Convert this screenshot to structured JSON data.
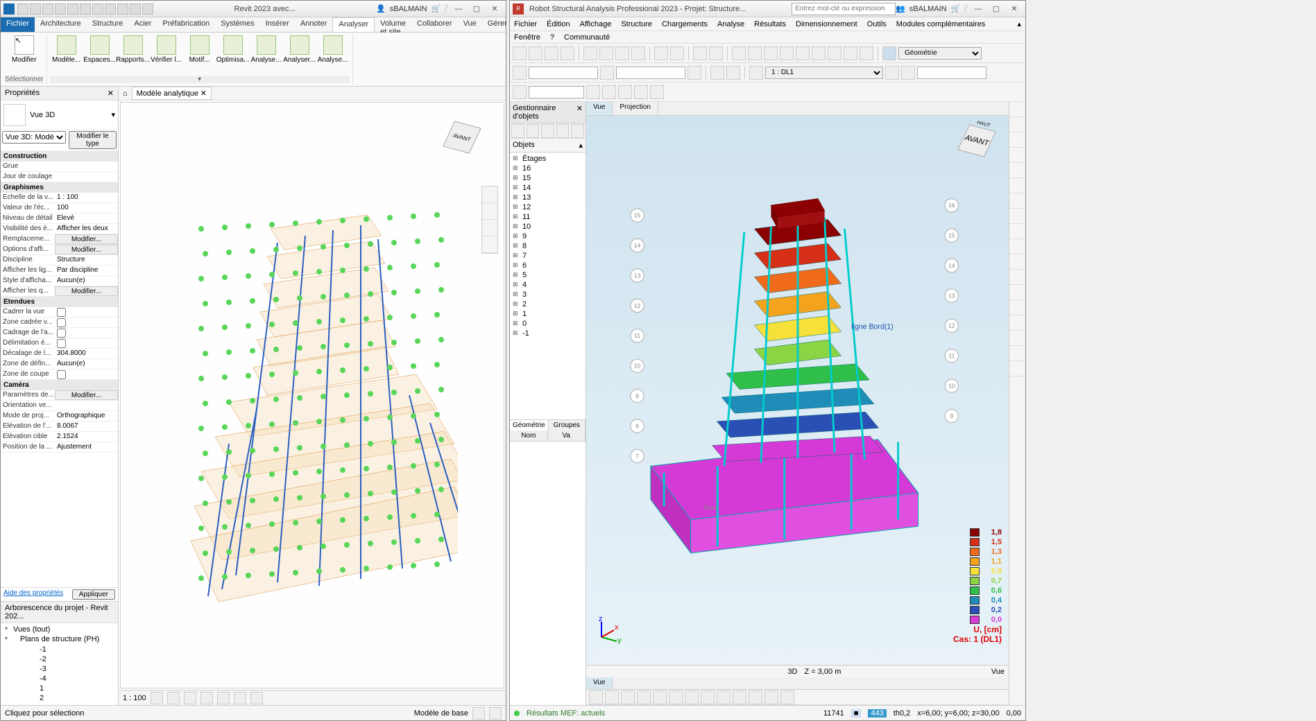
{
  "revit": {
    "title": "Revit 2023 avec...",
    "user": "sBALMAIN",
    "tabs": [
      "Fichier",
      "Architecture",
      "Structure",
      "Acier",
      "Préfabrication",
      "Systèmes",
      "Insérer",
      "Annoter",
      "Analyser",
      "Volume et site",
      "Collaborer",
      "Vue",
      "Gérer"
    ],
    "active_tab": "Analyser",
    "ribbon": {
      "select_panel": "Sélectionner",
      "buttons": [
        "Modifier",
        "Modèle...",
        "Espaces...",
        "Rapports...",
        "Vérifier l...",
        "Motif...",
        "Optimisa...",
        "Analyse...",
        "Analyser...",
        "Analyse..."
      ]
    },
    "view_tab": "Modèle analytique",
    "viewcube_face": "AVANT",
    "properties": {
      "header": "Propriétés",
      "type_name": "Vue 3D",
      "instance_selector": "Vue 3D: Modè",
      "edit_type": "Modifier le type",
      "groups": [
        {
          "name": "Construction",
          "rows": [
            {
              "k": "Grue",
              "v": ""
            },
            {
              "k": "Jour de coulage",
              "v": ""
            }
          ]
        },
        {
          "name": "Graphismes",
          "rows": [
            {
              "k": "Echelle de la v...",
              "v": "1 : 100"
            },
            {
              "k": "Valeur de l'éc...",
              "v": "100"
            },
            {
              "k": "Niveau de détail",
              "v": "Elevé"
            },
            {
              "k": "Visibilité des é...",
              "v": "Afficher les deux"
            },
            {
              "k": "Remplaceme...",
              "v": "Modifier...",
              "btn": true
            },
            {
              "k": "Options d'affi...",
              "v": "Modifier...",
              "btn": true
            },
            {
              "k": "Discipline",
              "v": "Structure"
            },
            {
              "k": "Afficher les lig...",
              "v": "Par discipline"
            },
            {
              "k": "Style d'afficha...",
              "v": "Aucun(e)"
            },
            {
              "k": "Afficher les q...",
              "v": "Modifier...",
              "btn": true
            }
          ]
        },
        {
          "name": "Etendues",
          "rows": [
            {
              "k": "Cadrer la vue",
              "v": "",
              "chk": true
            },
            {
              "k": "Zone cadrée v...",
              "v": "",
              "chk": true
            },
            {
              "k": "Cadrage de l'a...",
              "v": "",
              "chk": true
            },
            {
              "k": "Délimitation é...",
              "v": "",
              "chk": true
            },
            {
              "k": "Décalage de l...",
              "v": "304.8000"
            },
            {
              "k": "Zone de défin...",
              "v": "Aucun(e)"
            },
            {
              "k": "Zone de coupe",
              "v": "",
              "chk": true
            }
          ]
        },
        {
          "name": "Caméra",
          "rows": [
            {
              "k": "Paramètres de...",
              "v": "Modifier...",
              "btn": true
            },
            {
              "k": "Orientation ve...",
              "v": ""
            },
            {
              "k": "Mode de proj...",
              "v": "Orthographique"
            },
            {
              "k": "Elévation de l'...",
              "v": "8.0067"
            },
            {
              "k": "Elévation cible",
              "v": "2.1524"
            },
            {
              "k": "Position de la ...",
              "v": "Ajustement"
            }
          ]
        }
      ],
      "help_link": "Aide des propriétés",
      "apply": "Appliquer"
    },
    "browser": {
      "header": "Arborescence du projet - Revit 202...",
      "root": "Vues (tout)",
      "node": "Plans de structure (PH)",
      "levels": [
        "-1",
        "-2",
        "-3",
        "-4",
        "1",
        "2"
      ]
    },
    "statusbar": {
      "hint": "Cliquez pour sélectionn",
      "scale": "1 : 100",
      "base": "Modèle de base"
    }
  },
  "robot": {
    "title": "Robot Structural Analysis Professional 2023 - Projet: Structure...",
    "search_placeholder": "Entrez mot-clé ou expression",
    "user": "sBALMAIN",
    "menus": [
      "Fichier",
      "Édition",
      "Affichage",
      "Structure",
      "Chargements",
      "Analyse",
      "Résultats",
      "Dimensionnement",
      "Outils",
      "Modules complémentaires",
      "Fenêtre",
      "?",
      "Communauté"
    ],
    "layout_dropdown": "Géométrie",
    "load_case": "1 : DL1",
    "object_manager": {
      "header": "Gestionnaire d'objets",
      "objects_label": "Objets",
      "storeys_label": "Étages",
      "storeys": [
        "16",
        "15",
        "14",
        "13",
        "12",
        "11",
        "10",
        "9",
        "8",
        "7",
        "6",
        "5",
        "4",
        "3",
        "2",
        "1",
        "0",
        "-1"
      ],
      "tabs": [
        "Géométrie",
        "Groupes"
      ],
      "cols": [
        "Nom",
        "Va"
      ]
    },
    "view_tabs": [
      "Vue",
      "Projection"
    ],
    "grid_bubbles_left": [
      "15",
      "14",
      "13",
      "12",
      "11",
      "10",
      "9",
      "8",
      "7"
    ],
    "grid_bubbles_right": [
      "16",
      "15",
      "14",
      "13",
      "12",
      "11",
      "10",
      "9"
    ],
    "viewcube_face": "AVANT",
    "viewcube_top": "HAUT",
    "annotation": "ligne Bord(1)",
    "base_label": "Base",
    "legend": {
      "values": [
        "1,8",
        "1,5",
        "1,3",
        "1,1",
        "0,9",
        "0,7",
        "0,6",
        "0,4",
        "0,2",
        "0,0"
      ],
      "colors": [
        "#8b0000",
        "#d62f18",
        "#f06a1c",
        "#f4a31e",
        "#f6e03a",
        "#8bd444",
        "#2fbf4a",
        "#1f8db8",
        "#2a4fb5",
        "#d63ad6"
      ],
      "unit": "U, [cm]",
      "case": "Cas: 1 (DL1)"
    },
    "vp_status": {
      "mode": "3D",
      "z": "Z = 3,00 m",
      "label_vue": "Vue"
    },
    "bottom_tab": "Vue",
    "statusbar": {
      "results": "Résultats MEF: actuels",
      "n1": "11741",
      "n2": "443",
      "th": "th0,2",
      "coords": "x=6,00; y=6,00; z=30,00",
      "zero": "0,00"
    }
  }
}
